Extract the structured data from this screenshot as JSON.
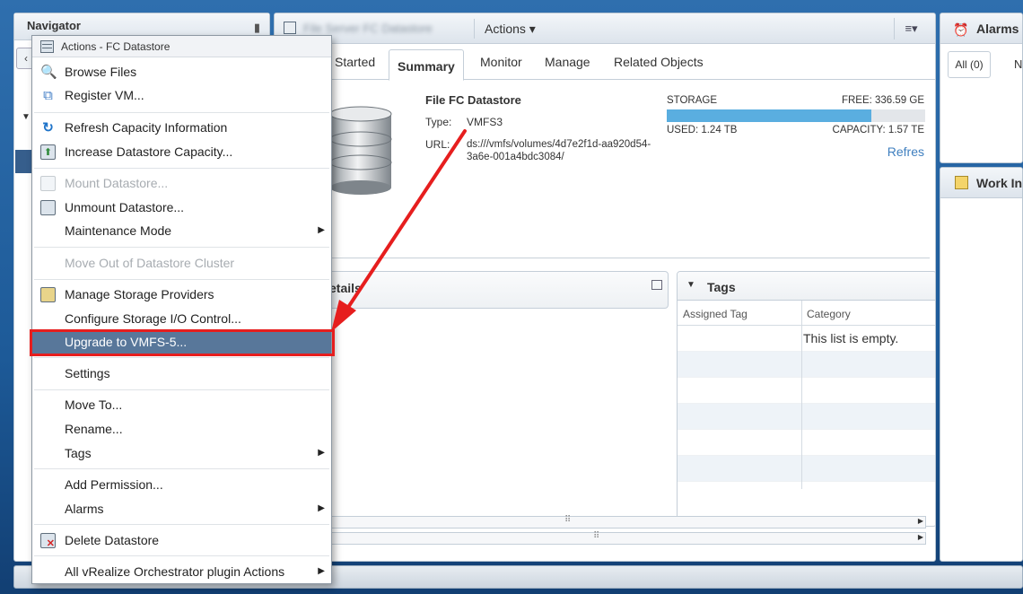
{
  "navigator": {
    "title": "Navigator",
    "pin_icon": "pin-icon",
    "back_icon": "back-arrow-icon"
  },
  "header": {
    "object_title": "File Server FC Datastore",
    "actions_label": "Actions ▾",
    "view_menu_label": "≡▾"
  },
  "tabs": [
    {
      "label": "Started"
    },
    {
      "label": "Summary",
      "active": true
    },
    {
      "label": "Monitor"
    },
    {
      "label": "Manage"
    },
    {
      "label": "Related Objects"
    }
  ],
  "summary": {
    "name": "File FC Datastore",
    "type_label": "Type:",
    "type_value": "VMFS3",
    "url_label": "URL:",
    "url_value": "ds:///vmfs/volumes/4d7e2f1d-aa920d54-3a6e-001a4bdc3084/"
  },
  "storage": {
    "label": "STORAGE",
    "free": "FREE: 336.59 GE",
    "used": "USED: 1.24 TB",
    "capacity": "CAPACITY: 1.57 TE",
    "used_fraction": 0.79,
    "refresh": "Refres"
  },
  "details_portlet": {
    "title": "etails"
  },
  "tags_portlet": {
    "title": "Tags",
    "columns": [
      "Assigned Tag",
      "Category"
    ],
    "empty_message": "This list is empty."
  },
  "alarms": {
    "title": "Alarms",
    "tab_all": "All (0)",
    "tab_n": "N"
  },
  "work_in_progress": {
    "title": "Work In"
  },
  "context_menu": {
    "title": "Actions - FC Datastore",
    "items": [
      {
        "label": "Browse Files",
        "icon": "browse-files-icon",
        "disabled": false
      },
      {
        "label": "Register VM...",
        "icon": "register-vm-icon",
        "disabled": false
      },
      {
        "label": "Refresh Capacity Information",
        "icon": "refresh-icon",
        "disabled": false
      },
      {
        "label": "Increase Datastore Capacity...",
        "icon": "increase-capacity-icon",
        "disabled": false
      },
      {
        "label": "Mount Datastore...",
        "icon": "mount-icon",
        "disabled": true
      },
      {
        "label": "Unmount Datastore...",
        "icon": "unmount-icon",
        "disabled": false
      },
      {
        "label": "Maintenance Mode",
        "submenu": true,
        "disabled": false
      },
      {
        "label": "Move Out of Datastore Cluster",
        "disabled": true
      },
      {
        "label": "Manage Storage Providers",
        "icon": "storage-providers-icon",
        "disabled": false
      },
      {
        "label": "Configure Storage I/O Control...",
        "disabled": false
      },
      {
        "label": "Upgrade to VMFS-5...",
        "highlighted": true,
        "disabled": false
      },
      {
        "label": "Settings",
        "disabled": false
      },
      {
        "label": "Move To...",
        "disabled": false
      },
      {
        "label": "Rename...",
        "disabled": false
      },
      {
        "label": "Tags",
        "submenu": true,
        "disabled": false
      },
      {
        "label": "Add Permission...",
        "disabled": false
      },
      {
        "label": "Alarms",
        "submenu": true,
        "disabled": false
      },
      {
        "label": "Delete Datastore",
        "icon": "delete-datastore-icon",
        "disabled": false
      },
      {
        "label": "All vRealize Orchestrator plugin Actions",
        "submenu": true,
        "disabled": false
      }
    ]
  },
  "colors": {
    "highlight": "#58779a",
    "annotation_red": "#e61e1e",
    "storage_fill": "#5aaee0",
    "link": "#3f7fbf"
  }
}
